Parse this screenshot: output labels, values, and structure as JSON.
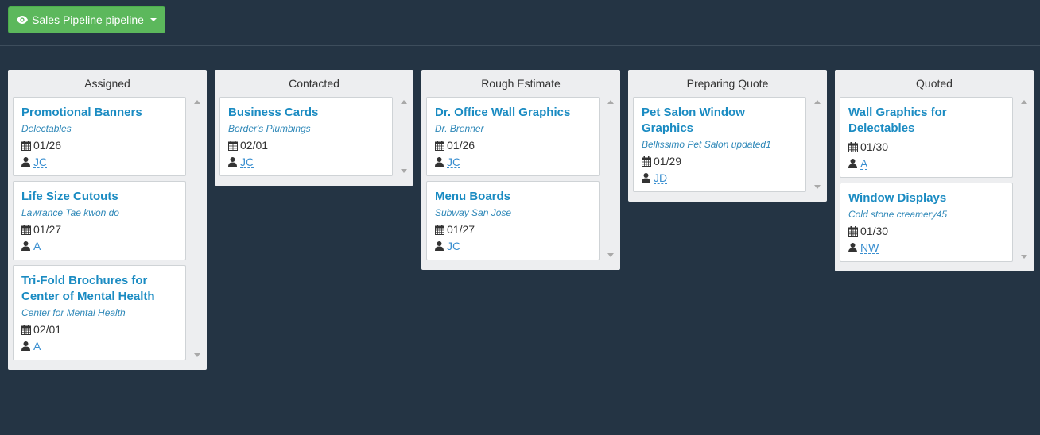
{
  "pipeline_button": {
    "label": "Sales Pipeline pipeline"
  },
  "columns": [
    {
      "title": "Assigned",
      "cards": [
        {
          "title": "Promotional Banners",
          "company": "Delectables",
          "date": "01/26",
          "user": "JC"
        },
        {
          "title": "Life Size Cutouts",
          "company": "Lawrance Tae kwon do",
          "date": "01/27",
          "user": "A"
        },
        {
          "title": "Tri-Fold Brochures for Center of Mental Health",
          "company": "Center for Mental Health",
          "date": "02/01",
          "user": "A"
        }
      ]
    },
    {
      "title": "Contacted",
      "cards": [
        {
          "title": "Business Cards",
          "company": "Border's Plumbings",
          "date": "02/01",
          "user": "JC"
        }
      ]
    },
    {
      "title": "Rough Estimate",
      "cards": [
        {
          "title": "Dr. Office Wall Graphics",
          "company": "Dr. Brenner",
          "date": "01/26",
          "user": "JC"
        },
        {
          "title": "Menu Boards",
          "company": "Subway San Jose",
          "date": "01/27",
          "user": "JC"
        }
      ]
    },
    {
      "title": "Preparing Quote",
      "cards": [
        {
          "title": "Pet Salon Window Graphics",
          "company": "Bellissimo Pet Salon updated1",
          "date": "01/29",
          "user": "JD"
        }
      ]
    },
    {
      "title": "Quoted",
      "cards": [
        {
          "title": "Wall Graphics for Delectables",
          "company": "",
          "date": "01/30",
          "user": "A"
        },
        {
          "title": "Window Displays",
          "company": "Cold stone creamery45",
          "date": "01/30",
          "user": "NW"
        }
      ]
    }
  ],
  "colors": {
    "background": "#243444",
    "button": "#5cb85c",
    "link": "#1a8bc2"
  }
}
